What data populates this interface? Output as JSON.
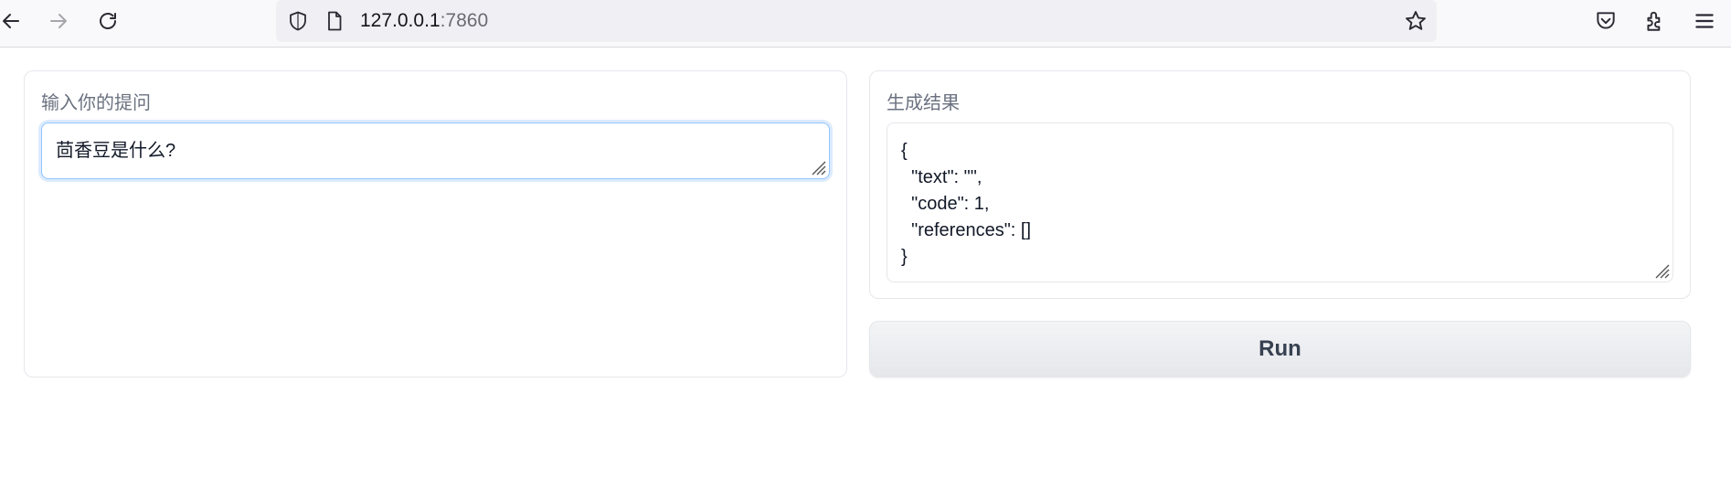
{
  "browser": {
    "url_host": "127.0.0.1",
    "url_port": ":7860",
    "icons": [
      "back-arrow-icon",
      "forward-arrow-icon",
      "reload-icon",
      "shield-icon",
      "page-icon",
      "bookmark-star-icon",
      "pocket-icon",
      "extensions-icon",
      "menu-icon"
    ]
  },
  "input_panel": {
    "label": "输入你的提问",
    "value": "茴香豆是什么?"
  },
  "output_panel": {
    "label": "生成结果",
    "value": "{\n  \"text\": \"\",\n  \"code\": 1,\n  \"references\": []\n}"
  },
  "run_button": {
    "label": "Run"
  },
  "colors": {
    "focus_border": "#93c5fd",
    "label_text": "#6b7280",
    "button_text": "#374151"
  }
}
